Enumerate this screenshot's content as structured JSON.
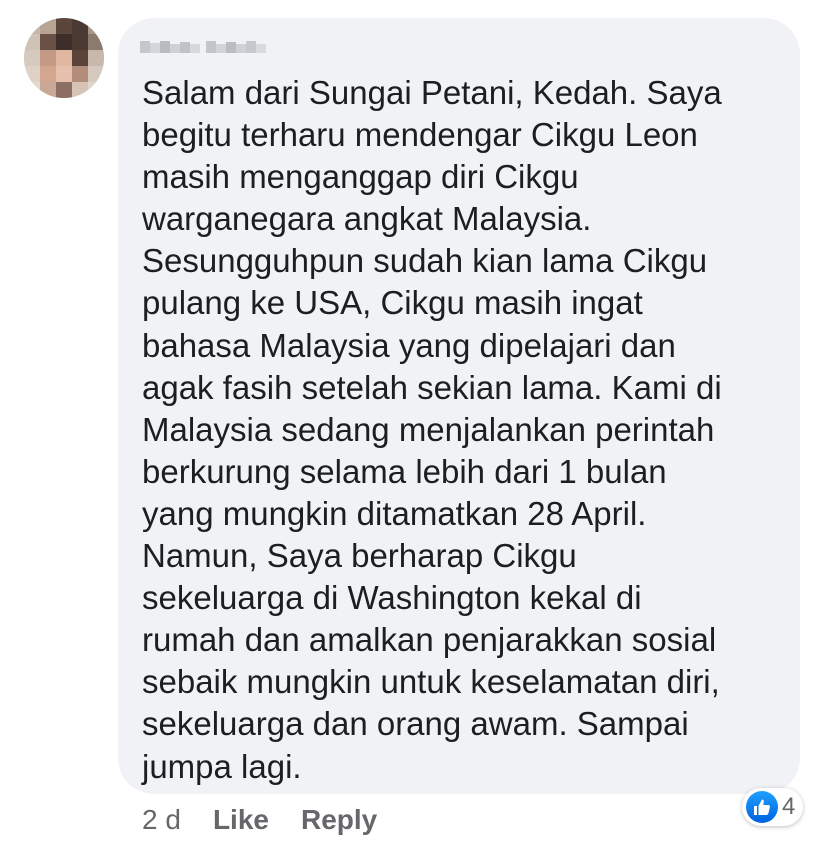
{
  "comment": {
    "lines": [
      {
        "text": "Salam dari Sungai Petani, Kedah. Saya",
        "underlined": ""
      },
      {
        "text": "begitu terharu mendengar Cikgu Leon",
        "underlined": ""
      },
      {
        "text": "masih menganggap diri Cikgu",
        "underlined": ""
      },
      {
        "text": "warganegara angkat Malaysia.",
        "underlined": ""
      },
      {
        "text": "",
        "underlined": "Sesungguhpun sudah kian lama Cikgu"
      },
      {
        "text": "",
        "underlined": "pulang ke USA, Cikgu masih ingat"
      },
      {
        "text": "",
        "underlined": "bahasa Malaysia yang dipelajari dan"
      },
      {
        "text": ". Kami di",
        "underlined": "agak fasih setelah sekian lama"
      },
      {
        "text": "Malaysia sedang menjalankan perintah",
        "underlined": ""
      },
      {
        "text": "berkurung selama lebih dari 1 bulan",
        "underlined": ""
      },
      {
        "text": "yang mungkin ditamatkan 28 April.",
        "underlined": ""
      },
      {
        "text": "",
        "underlined": "Namun, Saya berharap Cikgu"
      },
      {
        "text": "",
        "underlined": "sekeluarga di Washington kekal di"
      },
      {
        "text": "",
        "underlined": "rumah dan amalkan penjarakkan sosial"
      },
      {
        "text": ",",
        "underlined": "sebaik mungkin untuk keselamatan diri"
      },
      {
        "text": ". Sampai",
        "underlined": "sekeluarga dan orang awam"
      },
      {
        "text": "jumpa lagi.",
        "underlined": ""
      }
    ]
  },
  "footer": {
    "timestamp": "2 d",
    "like_label": "Like",
    "reply_label": "Reply"
  },
  "reactions": {
    "icon": "thumbs-up-icon",
    "count": "4"
  },
  "colors": {
    "bubble": "#f0f2f5",
    "text": "#1c1e21",
    "meta": "#65676b",
    "underline": "#e41e3f",
    "like_blue": "#1877f2"
  }
}
